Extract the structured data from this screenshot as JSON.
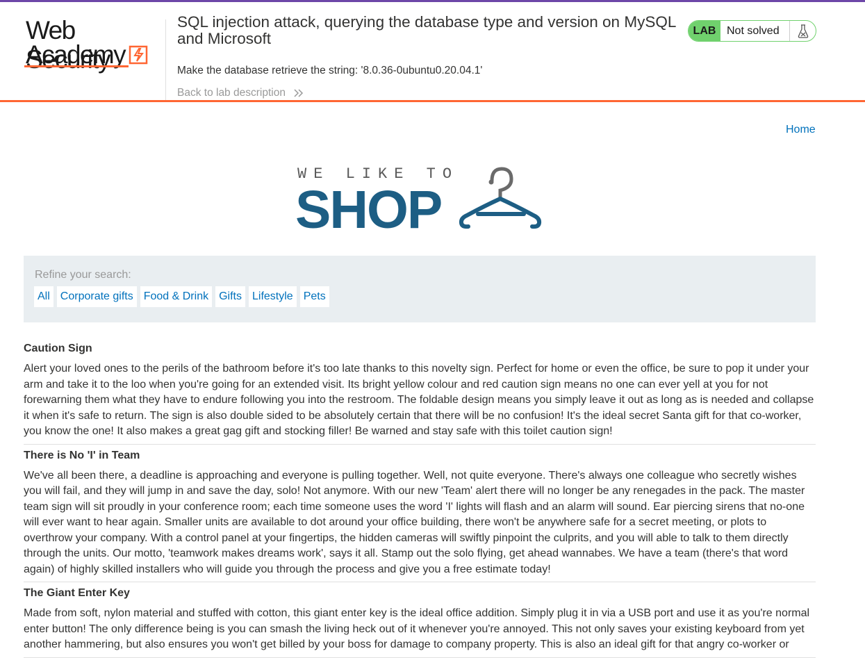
{
  "header": {
    "logo_line1": "Web Security",
    "logo_line2": "Academy",
    "lab_title": "SQL injection attack, querying the database type and version on MySQL and Microsoft",
    "lab_goal": "Make the database retrieve the string: '8.0.36-0ubuntu0.20.04.1'",
    "back_link": "Back to lab description",
    "lab_badge": "LAB",
    "lab_status": "Not solved",
    "lab_icon": "flask-icon"
  },
  "nav": {
    "home": "Home"
  },
  "shop_logo": {
    "tagline": "WE LIKE TO",
    "name": "SHOP",
    "icon": "hanger-icon"
  },
  "filters": {
    "label": "Refine your search:",
    "categories": [
      "All",
      "Corporate gifts",
      "Food & Drink",
      "Gifts",
      "Lifestyle",
      "Pets"
    ]
  },
  "products": [
    {
      "title": "Caution Sign",
      "description": "Alert your loved ones to the perils of the bathroom before it's too late thanks to this novelty sign. Perfect for home or even the office, be sure to pop it under your arm and take it to the loo when you're going for an extended visit. Its bright yellow colour and red caution sign means no one can ever yell at you for not forewarning them what they have to endure following you into the restroom. The foldable design means you simply leave it out as long as is needed and collapse it when it's safe to return. The sign is also double sided to be absolutely certain that there will be no confusion! It's the ideal secret Santa gift for that co-worker, you know the one! It also makes a great gag gift and stocking filler! Be warned and stay safe with this toilet caution sign!"
    },
    {
      "title": "There is No 'I' in Team",
      "description": "We've all been there, a deadline is approaching and everyone is pulling together. Well, not quite everyone. There's always one colleague who secretly wishes you will fail, and they will jump in and save the day, solo! Not anymore. With our new 'Team' alert there will no longer be any renegades in the pack. The master team sign will sit proudly in your conference room; each time someone uses the word 'I' lights will flash and an alarm will sound. Ear piercing sirens that no-one will ever want to hear again. Smaller units are available to dot around your office building, there won't be anywhere safe for a secret meeting, or plots to overthrow your company. With a control panel at your fingertips, the hidden cameras will swiftly pinpoint the culprits, and you will able to talk to them directly through the units. Our motto, 'teamwork makes dreams work', says it all. Stamp out the solo flying, get ahead wannabes. We have a team (there's that word again) of highly skilled installers who will guide you through the process and give you a free estimate today!"
    },
    {
      "title": "The Giant Enter Key",
      "description": "Made from soft, nylon material and stuffed with cotton, this giant enter key is the ideal office addition. Simply plug it in via a USB port and use it as you're normal enter button! The only difference being is you can smash the living heck out of it whenever you're annoyed. This not only saves your existing keyboard from yet another hammering, but also ensures you won't get billed by your boss for damage to company property. This is also an ideal gift for that angry co-worker or"
    }
  ],
  "colors": {
    "accent_orange": "#ff6633",
    "top_bar_purple": "#6d47a8",
    "link_blue": "#0071bc",
    "lab_green": "#70d16d",
    "shop_blue": "#1d5e84"
  }
}
